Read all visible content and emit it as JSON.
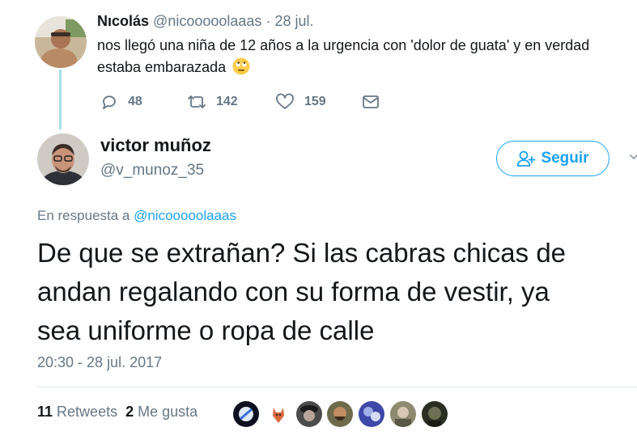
{
  "parent_tweet": {
    "name": "Nıcolás",
    "handle": "@nicooooolaaas",
    "separator": "·",
    "date": "28 jul.",
    "text": "nos llegó una niña de 12 años a la urgencia con 'dolor de guata' y en verdad estaba embarazada",
    "emoji": "rolling-eyes-emoji",
    "actions": {
      "replies": "48",
      "retweets": "142",
      "likes": "159"
    }
  },
  "main_tweet": {
    "name": "victor muñoz",
    "handle": "@v_munoz_35",
    "follow_label": "Seguir",
    "reply_prefix": "En respuesta a",
    "reply_handle": "@nicooooolaaas",
    "text_lines": [
      "De que se extrañan? Si las cabras chicas de",
      "andan regalando con su forma de vestir, ya",
      "sea uniforme o ropa de calle"
    ],
    "timestamp": "20:30 - 28 jul. 2017",
    "stats": {
      "retweets_count": "11",
      "retweets_label": "Retweets",
      "likes_count": "2",
      "likes_label": "Me gusta"
    },
    "liker_count": 7
  },
  "colors": {
    "accent": "#1da1f2",
    "muted": "#657786",
    "text": "#14171a",
    "thread_line": "#a6e0ea",
    "divider": "#e6ecf0"
  },
  "icons": [
    "reply-icon",
    "retweet-icon",
    "heart-icon",
    "envelope-icon",
    "follow-person-icon",
    "chevron-down-icon"
  ]
}
